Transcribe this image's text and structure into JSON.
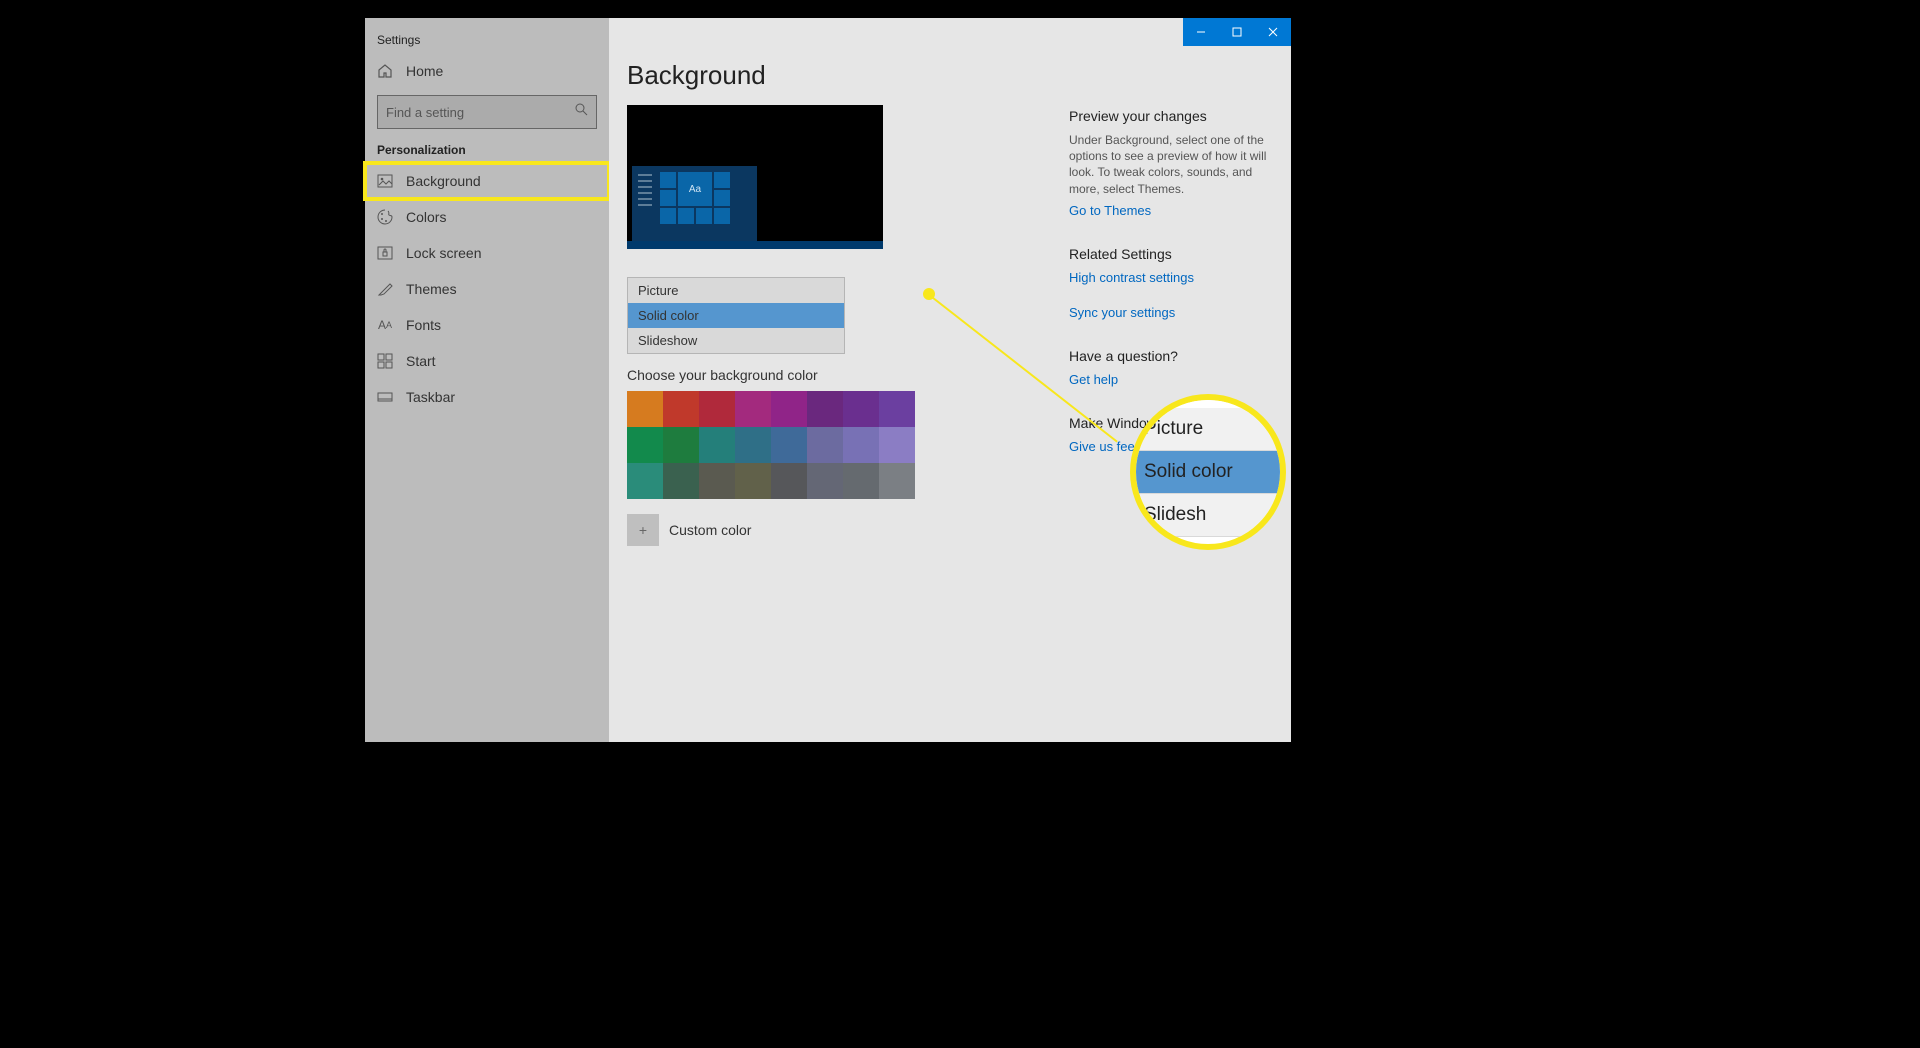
{
  "window": {
    "title": "Settings"
  },
  "sidebar": {
    "home": "Home",
    "search_placeholder": "Find a setting",
    "section": "Personalization",
    "items": [
      {
        "label": "Background",
        "icon": "picture-icon",
        "highlighted": true
      },
      {
        "label": "Colors",
        "icon": "palette-icon"
      },
      {
        "label": "Lock screen",
        "icon": "lock-icon"
      },
      {
        "label": "Themes",
        "icon": "brush-icon"
      },
      {
        "label": "Fonts",
        "icon": "font-icon"
      },
      {
        "label": "Start",
        "icon": "start-icon"
      },
      {
        "label": "Taskbar",
        "icon": "taskbar-icon"
      }
    ]
  },
  "main": {
    "title": "Background",
    "preview_sample": "Aa",
    "dropdown": {
      "options": [
        "Picture",
        "Solid color",
        "Slideshow"
      ],
      "selected": "Solid color"
    },
    "color_section": "Choose your background color",
    "colors": [
      "#d67b1f",
      "#c0392b",
      "#b0293b",
      "#a32a7e",
      "#902488",
      "#6a287e",
      "#6a2f8f",
      "#6b3fa0",
      "#128a4c",
      "#1e7c3e",
      "#247f7a",
      "#2f6f87",
      "#3f6a99",
      "#6c6ba0",
      "#7871b5",
      "#8b7dc4",
      "#2a8c7a",
      "#3a614f",
      "#5a5a50",
      "#61614a",
      "#56575a",
      "#646775",
      "#656a6f",
      "#7b7f84"
    ],
    "custom_color": "Custom color"
  },
  "right": {
    "preview_head": "Preview your changes",
    "preview_body": "Under Background, select one of the options to see a preview of how it will look. To tweak colors, sounds, and more, select Themes.",
    "themes_link": "Go to Themes",
    "related_head": "Related Settings",
    "related_links": [
      "High contrast settings",
      "Sync your settings"
    ],
    "question_head": "Have a question?",
    "question_link": "Get help",
    "better_head": "Make Windows better",
    "better_link": "Give us feedback"
  },
  "zoom": {
    "options": [
      "Picture",
      "Solid color",
      "Slidesh"
    ]
  }
}
